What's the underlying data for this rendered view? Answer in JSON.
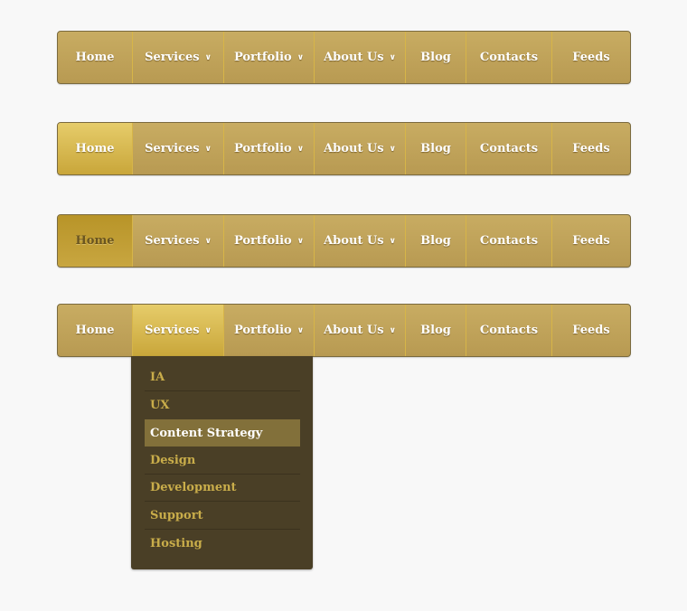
{
  "nav": {
    "items": [
      {
        "label": "Home",
        "has_dropdown": false
      },
      {
        "label": "Services",
        "has_dropdown": true
      },
      {
        "label": "Portfolio",
        "has_dropdown": true
      },
      {
        "label": "About Us",
        "has_dropdown": true
      },
      {
        "label": "Blog",
        "has_dropdown": false
      },
      {
        "label": "Contacts",
        "has_dropdown": false
      },
      {
        "label": "Feeds",
        "has_dropdown": false
      }
    ],
    "chevron_icon": "chevron-down-icon"
  },
  "bars": [
    {
      "state": "normal",
      "highlighted_index": null
    },
    {
      "state": "hover",
      "highlighted_index": 0
    },
    {
      "state": "pressed",
      "highlighted_index": 0
    },
    {
      "state": "dropdown-open",
      "highlighted_index": 1
    }
  ],
  "dropdown": {
    "items": [
      "IA",
      "UX",
      "Content Strategy",
      "Design",
      "Development",
      "Support",
      "Hosting"
    ],
    "active_index": 2
  },
  "colors": {
    "bar": "#c0a35a",
    "hover": "#dcc059",
    "dropdown_bg": "#4a3f26",
    "dropdown_text": "#c9ad4a",
    "dropdown_active": "#82703a"
  }
}
